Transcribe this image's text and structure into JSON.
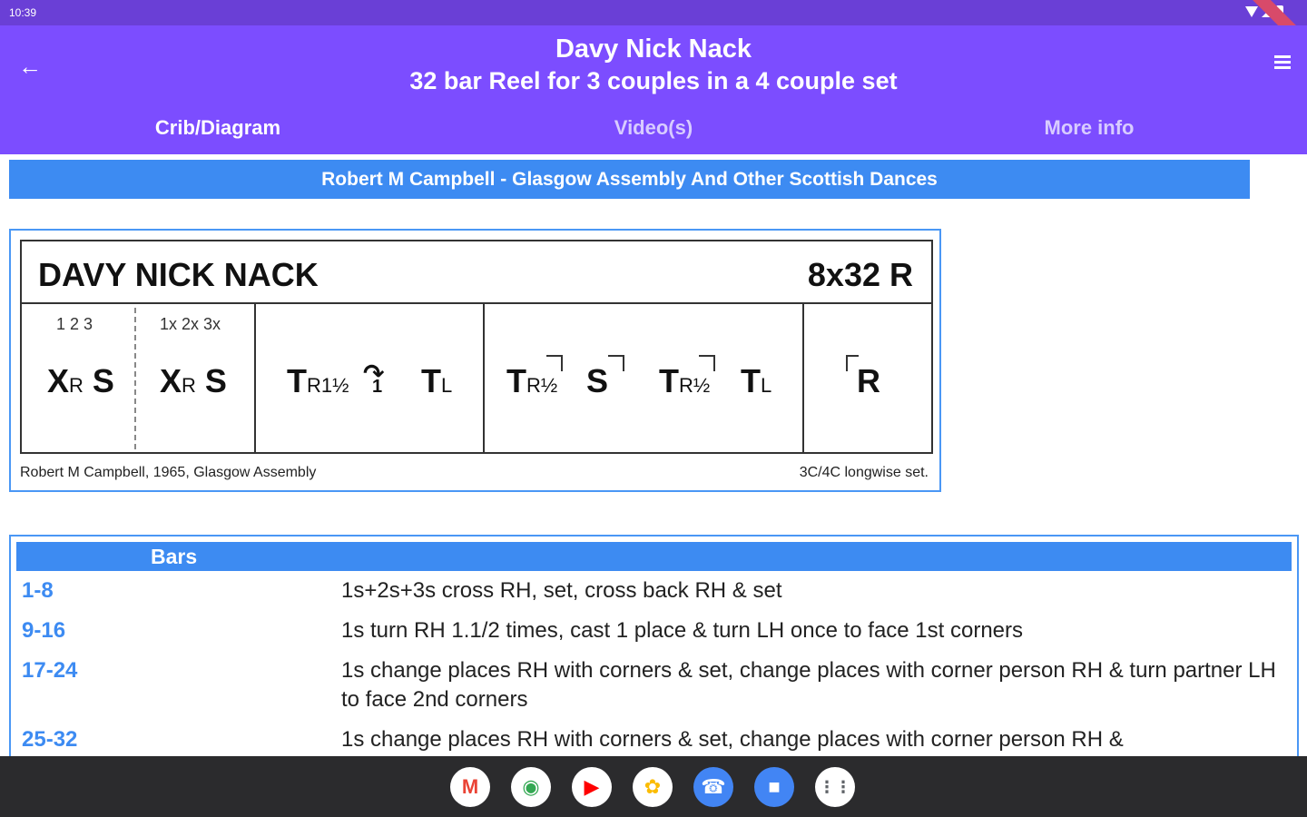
{
  "status": {
    "time": "10:39"
  },
  "header": {
    "back_icon": "arrow-left-icon",
    "title": "Davy Nick Nack",
    "subtitle": "32 bar Reel for 3 couples in a 4 couple set",
    "menu_icon": "hamburger-icon"
  },
  "tabs": [
    {
      "label": "Crib/Diagram",
      "active": true
    },
    {
      "label": "Video(s)",
      "active": false
    },
    {
      "label": "More info",
      "active": false
    }
  ],
  "banner": "Robert M Campbell - Glasgow Assembly And Other Scottish Dances",
  "diagram": {
    "title": "DAVY NICK NACK",
    "bars": "8x32 R",
    "cells": {
      "c1_top": "1 2 3",
      "c1_sym": "X",
      "c1_sub": "R",
      "c1_s": "S",
      "c2_top": "1x 2x 3x",
      "c2_sym": "X",
      "c2_sub": "R",
      "c2_s": "S",
      "c3_t1": "T",
      "c3_sub1": "R1½",
      "c3_cast": "1",
      "c3_t2": "T",
      "c3_sub2": "L",
      "c4_t1": "T",
      "c4_sub1": "R½",
      "c4_s": "S",
      "c4_t2": "T",
      "c4_sub2": "R½",
      "c4_t3": "T",
      "c4_sub3": "L",
      "c5_r": "R"
    },
    "credit_left": "Robert M Campbell, 1965, Glasgow Assembly",
    "credit_right": "3C/4C longwise set."
  },
  "table": {
    "header": "Bars",
    "rows": [
      {
        "bars": "1-8",
        "desc": "1s+2s+3s cross RH, set, cross back RH & set"
      },
      {
        "bars": "9-16",
        "desc": "1s turn RH 1.1/2 times, cast 1 place & turn LH once to face 1st corners"
      },
      {
        "bars": "17-24",
        "desc": "1s change places RH with corners & set, change places with corner person RH & turn partner LH to face 2nd corners"
      },
      {
        "bars": "25-32",
        "desc": "1s change places RH with corners & set, change places with corner person RH &"
      }
    ]
  },
  "dock": [
    {
      "icon": "gmail-icon",
      "color": "#ea4335"
    },
    {
      "icon": "chrome-icon",
      "color": "#34a853"
    },
    {
      "icon": "youtube-icon",
      "color": "#ff0000"
    },
    {
      "icon": "photos-icon",
      "color": "#fbbc04"
    },
    {
      "icon": "phone-icon",
      "color": "#4285f4"
    },
    {
      "icon": "messages-icon",
      "color": "#4285f4"
    },
    {
      "icon": "app-drawer-icon",
      "color": "#5f6368"
    }
  ]
}
